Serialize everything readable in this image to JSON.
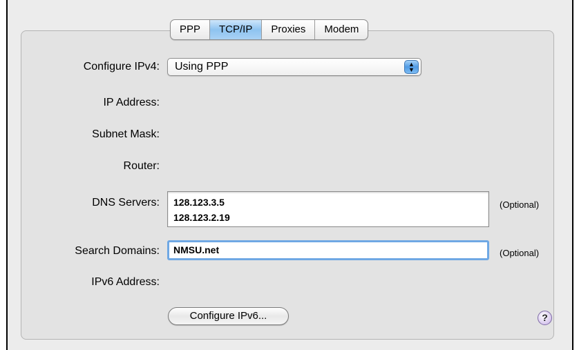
{
  "tabs": [
    {
      "label": "PPP",
      "active": false
    },
    {
      "label": "TCP/IP",
      "active": true
    },
    {
      "label": "Proxies",
      "active": false
    },
    {
      "label": "Modem",
      "active": false
    }
  ],
  "configure_ipv4": {
    "label": "Configure IPv4:",
    "value": "Using PPP"
  },
  "ip_address": {
    "label": "IP Address:"
  },
  "subnet_mask": {
    "label": "Subnet Mask:"
  },
  "router": {
    "label": "Router:"
  },
  "dns_servers": {
    "label": "DNS Servers:",
    "values": [
      "128.123.3.5",
      "128.123.2.19"
    ],
    "note": "(Optional)"
  },
  "search_domains": {
    "label": "Search Domains:",
    "value": "NMSU.net",
    "note": "(Optional)"
  },
  "ipv6_address": {
    "label": "IPv6 Address:"
  },
  "configure_ipv6_button": {
    "label": "Configure IPv6..."
  },
  "help_button": {
    "label": "?"
  },
  "colors": {
    "tab_active": "#8ec3f0",
    "popup_arrows": "#4f9ae4",
    "focus_ring": "#6fa8e4",
    "help_button": "#d8c8ee"
  }
}
